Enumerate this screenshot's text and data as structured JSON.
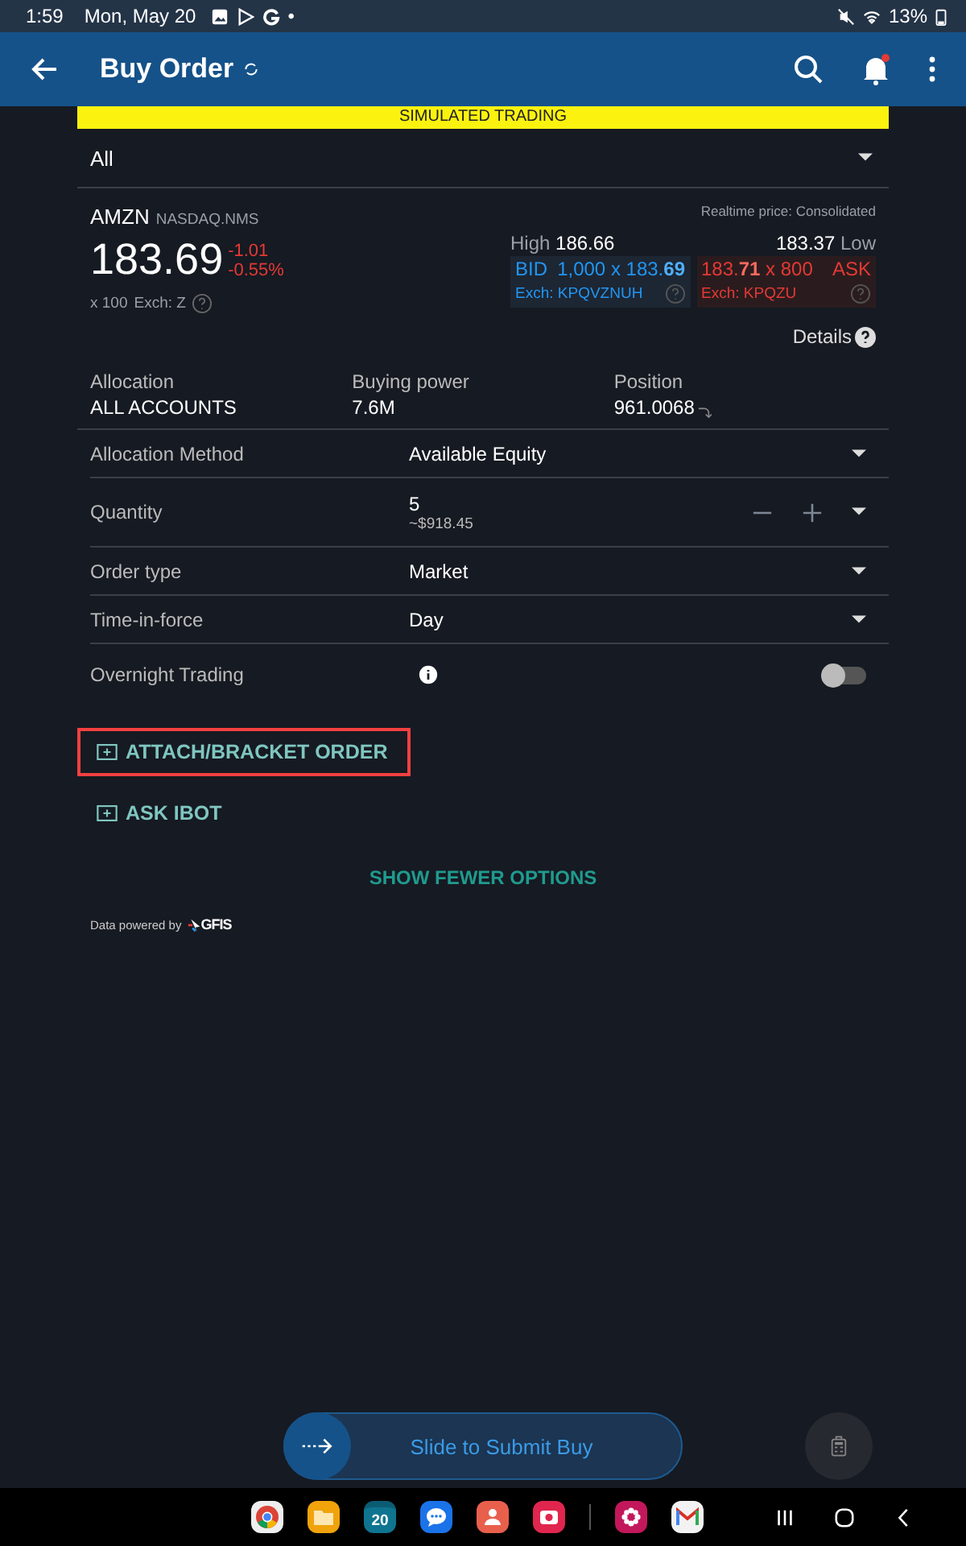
{
  "status_bar": {
    "time": "1:59",
    "date": "Mon, May 20",
    "dot": "•",
    "battery": "13%"
  },
  "app_bar": {
    "title": "Buy Order"
  },
  "banner": "SIMULATED TRADING",
  "account_select": {
    "value": "All"
  },
  "quote": {
    "symbol": "AMZN",
    "exchange": "NASDAQ.NMS",
    "price": "183.69",
    "change": "-1.01",
    "change_pct": "-0.55%",
    "multiplier": "x 100",
    "exch": "Exch: Z",
    "realtime": "Realtime price: Consolidated",
    "high_label": "High",
    "high": "186.66",
    "low": "183.37",
    "low_label": "Low",
    "bid": {
      "label": "BID",
      "quote": "1,000 x 183.**69**",
      "exch": "Exch: KPQVZNUH"
    },
    "ask": {
      "label": "ASK",
      "quote": "183.**71** x 800",
      "exch": "Exch: KPQZU"
    }
  },
  "details": "Details",
  "summary": [
    {
      "label": "Allocation",
      "value": "ALL ACCOUNTS",
      "arrow": false
    },
    {
      "label": "Buying power",
      "value": "7.6M",
      "arrow": false
    },
    {
      "label": "Position",
      "value": "961.0068",
      "arrow": true
    }
  ],
  "fields": [
    {
      "kind": "select",
      "label": "Allocation Method",
      "value": "Available Equity"
    },
    {
      "kind": "quantity",
      "label": "Quantity",
      "value": "5",
      "sub": "~$918.45"
    },
    {
      "kind": "select",
      "label": "Order type",
      "value": "Market"
    },
    {
      "kind": "select",
      "label": "Time-in-force",
      "value": "Day"
    }
  ],
  "overnight": {
    "label": "Overnight Trading",
    "on": false
  },
  "actions": [
    {
      "label": "ATTACH/BRACKET ORDER",
      "highlighted": true
    },
    {
      "label": "ASK IBOT",
      "highlighted": false
    }
  ],
  "show_fewer": "SHOW FEWER OPTIONS",
  "powered": {
    "text": "Data powered by",
    "logo": "GFIS"
  },
  "slider": {
    "label": "Slide to Submit Buy"
  },
  "dock": {
    "calendar_day": "20"
  }
}
